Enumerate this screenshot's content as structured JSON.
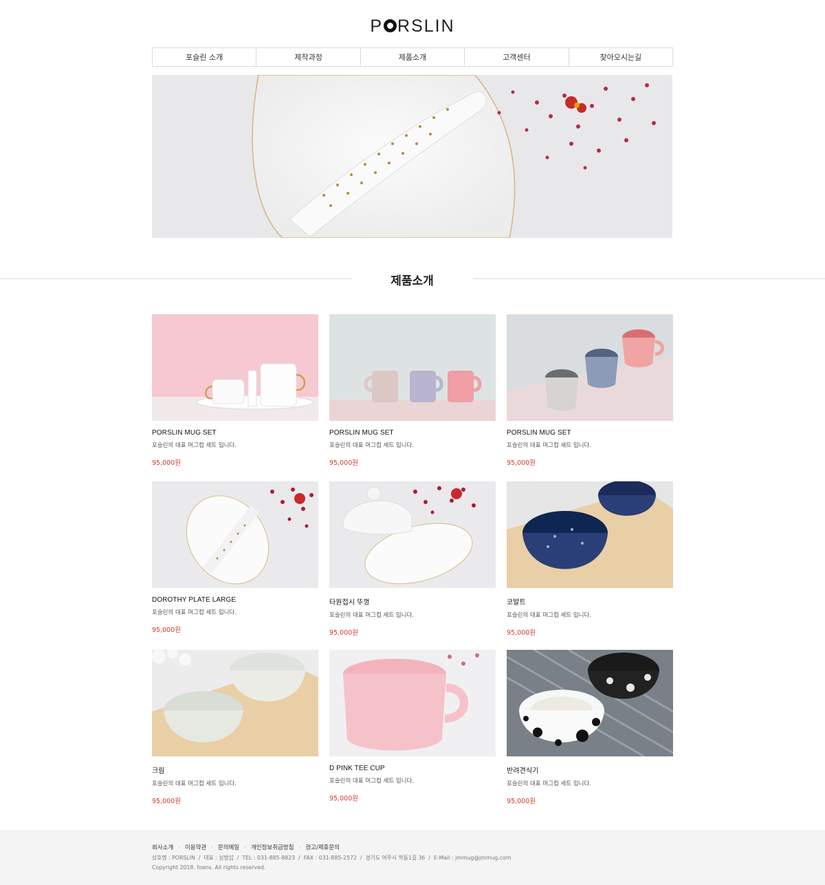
{
  "header": {
    "logo_pre": "P",
    "logo_post": "RSLIN"
  },
  "nav": {
    "items": [
      {
        "label": "포슬린 소개"
      },
      {
        "label": "제작과정"
      },
      {
        "label": "제품소개"
      },
      {
        "label": "고객센터"
      },
      {
        "label": "찾아오시는길"
      }
    ]
  },
  "section": {
    "title": "제품소개"
  },
  "products": [
    {
      "name": "PORSLIN MUG SET",
      "desc": "포슬린의 대표 머그컵 세트 입니다.",
      "price": "95,000원"
    },
    {
      "name": "PORSLIN MUG SET",
      "desc": "포슬린의 대표 머그컵 세트 입니다.",
      "price": "95,000원"
    },
    {
      "name": "PORSLIN MUG SET",
      "desc": "포슬린의 대표 머그컵 세트 입니다.",
      "price": "95,000원"
    },
    {
      "name": "DOROTHY PLATE LARGE",
      "desc": "포슬린의 대표 머그컵 세트 입니다.",
      "price": "95,000원"
    },
    {
      "name": "타원접시 뚜껑",
      "desc": "포슬린의 대표 머그컵 세트 입니다.",
      "price": "95,000원"
    },
    {
      "name": "코발트",
      "desc": "포슬린의 대표 머그컵 세트 입니다.",
      "price": "95,000원"
    },
    {
      "name": "크림",
      "desc": "포슬린의 대표 머그컵 세트 입니다.",
      "price": "95,000원"
    },
    {
      "name": "D PINK TEE CUP",
      "desc": "포슬린의 대표 머그컵 세트 입니다.",
      "price": "95,000원"
    },
    {
      "name": "반려견식기",
      "desc": "포슬린의 대표 머그컵 세트 입니다.",
      "price": "95,000원"
    }
  ],
  "footer": {
    "links": [
      "회사소개",
      "이용약관",
      "문의메일",
      "개인정보취급방침",
      "광고/제휴문의"
    ],
    "link_separator": "·",
    "info": "상호명 : PORSLIN  /  대표 : 심명섭  /  TEL : 031-885-8823  /  FAX : 031-885-2572  /  경기도 여주시 학동1길 36  /  E-Mail : jmmug@jmmug.com",
    "copyright": "Copyright 2018. foens. All rights reserved."
  },
  "colors": {
    "price": "#d33a2c",
    "footer_bg": "#f4f4f4",
    "border": "#d9d9d9"
  }
}
